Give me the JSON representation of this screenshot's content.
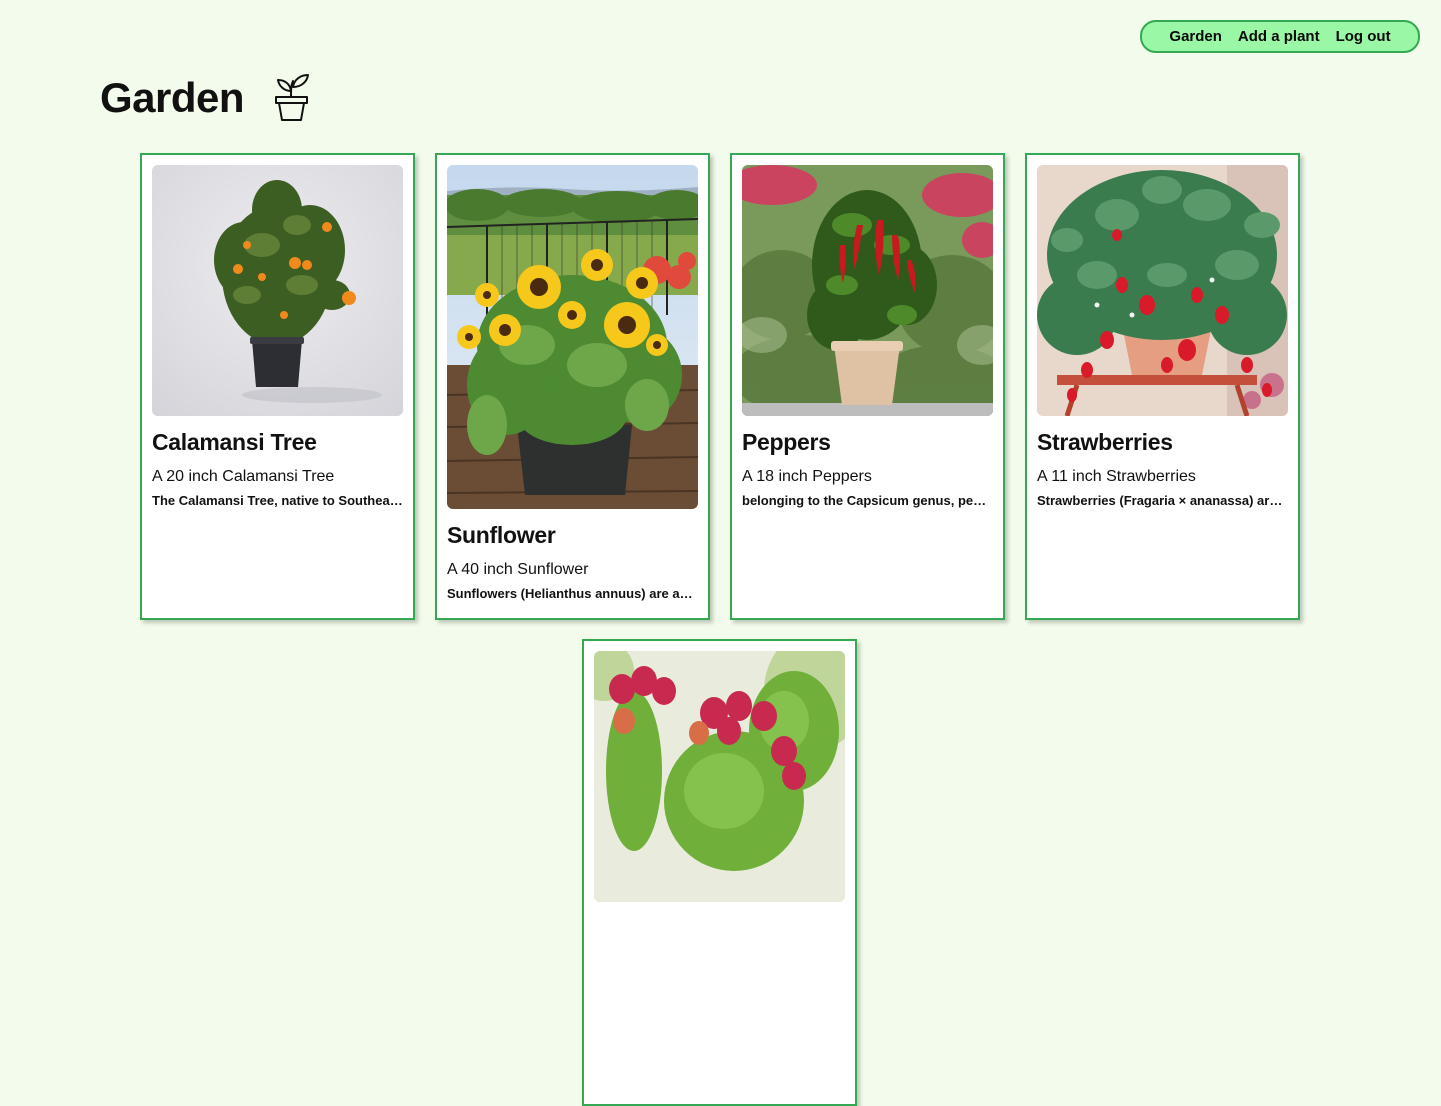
{
  "nav": {
    "garden": "Garden",
    "add_plant": "Add a plant",
    "logout": "Log out"
  },
  "page": {
    "title": "Garden"
  },
  "plants": [
    {
      "name": "Calamansi Tree",
      "size": "A 20 inch Calamansi Tree",
      "description": "The Calamansi Tree, native to Southeast Asia"
    },
    {
      "name": "Sunflower",
      "size": "A 40 inch Sunflower",
      "description": "Sunflowers (Helianthus annuus) are annual plants"
    },
    {
      "name": "Peppers",
      "size": "A 18 inch Peppers",
      "description": "belonging to the Capsicum genus, peppers are"
    },
    {
      "name": "Strawberries",
      "size": "A 11 inch Strawberries",
      "description": "Strawberries (Fragaria × ananassa) are perennial"
    },
    {
      "name": "",
      "size": "",
      "description": ""
    }
  ],
  "colors": {
    "background": "#f3fcec",
    "nav_fill": "#99f7a6",
    "accent": "#34a852"
  },
  "icons": {
    "title_icon": "potted-sprout-icon"
  }
}
